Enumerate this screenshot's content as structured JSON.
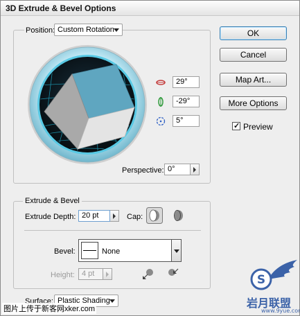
{
  "window": {
    "title": "3D Extrude & Bevel Options"
  },
  "position": {
    "label": "Position:",
    "selected": "Custom Rotation",
    "rotation_x": "29°",
    "rotation_y": "-29°",
    "rotation_z": "5°",
    "perspective_label": "Perspective:",
    "perspective_value": "0°"
  },
  "buttons": {
    "ok": "OK",
    "cancel": "Cancel",
    "map_art": "Map Art...",
    "more_options": "More Options",
    "preview_label": "Preview",
    "preview_checked": true
  },
  "extrude": {
    "section_label": "Extrude & Bevel",
    "depth_label": "Extrude Depth:",
    "depth_value": "20 pt",
    "cap_label": "Cap:",
    "bevel_label": "Bevel:",
    "bevel_value": "None",
    "height_label": "Height:",
    "height_value": "4 pt"
  },
  "surface": {
    "label": "Surface:",
    "selected": "Plastic Shading"
  },
  "footer": {
    "caption": "图片上传于新客网xker.com"
  },
  "colors": {
    "cube_top": "#5fa6c0",
    "cube_left": "#a9a9a9",
    "cube_right": "#e4e4e4",
    "trackball_ring": "#58c9e4"
  },
  "watermark": {
    "logo_letter": "S",
    "brand_text": "岩月联盟",
    "url_text": "www.9yue.com"
  }
}
